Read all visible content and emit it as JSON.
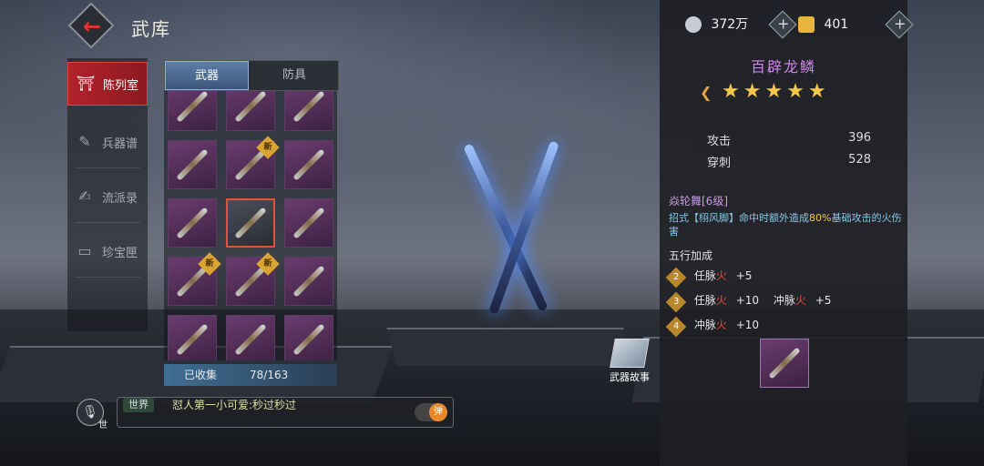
{
  "header": {
    "title": "武库"
  },
  "side_nav": {
    "items": [
      {
        "label": "陈列室",
        "icon": "gate-icon",
        "active": true
      },
      {
        "label": "兵器谱",
        "icon": "scroll-icon",
        "active": false
      },
      {
        "label": "流派录",
        "icon": "book-icon",
        "active": false
      },
      {
        "label": "珍宝匣",
        "icon": "chest-icon",
        "active": false
      }
    ]
  },
  "tabs": [
    {
      "label": "武器"
    },
    {
      "label": "防具"
    }
  ],
  "grid": {
    "badge_text": "新",
    "collected_label": "已收集",
    "collected_count": "78/163"
  },
  "chat": {
    "channel": "世界",
    "message": "怼人第一小可爱:秒过秒过",
    "mic_sub": "世",
    "toggle_label": "弹"
  },
  "story_button": {
    "label": "武器故事"
  },
  "currency": {
    "silver": "372万",
    "gold": "401",
    "silver_icon": "coin-icon",
    "gold_icon": "ingot-icon"
  },
  "weapon": {
    "name": "百辟龙鳞",
    "stars": "★★★★★",
    "star_count": 5,
    "stats": [
      {
        "label": "攻击",
        "value": "396"
      },
      {
        "label": "穿刺",
        "value": "528"
      }
    ],
    "skill_name": "焱轮舞[6级]",
    "skill_desc_a": "招式【栩风脚】命中时额外造成",
    "skill_desc_hl": "80%",
    "skill_desc_b": "基础攻击的火伤害",
    "elements_title": "五行加成",
    "elements": [
      {
        "num": "2",
        "text": "任脉",
        "el": "火",
        "bonus": "+5"
      },
      {
        "num": "3",
        "text": "任脉",
        "el": "火",
        "bonus": "+10",
        "text2": "冲脉",
        "el2": "火",
        "bonus2": "+5"
      },
      {
        "num": "4",
        "text": "冲脉",
        "el": "火",
        "bonus": "+10"
      }
    ]
  },
  "colors": {
    "accent_red": "#b3222a",
    "purple_name": "#cf86e8",
    "star": "#f2c74a"
  }
}
